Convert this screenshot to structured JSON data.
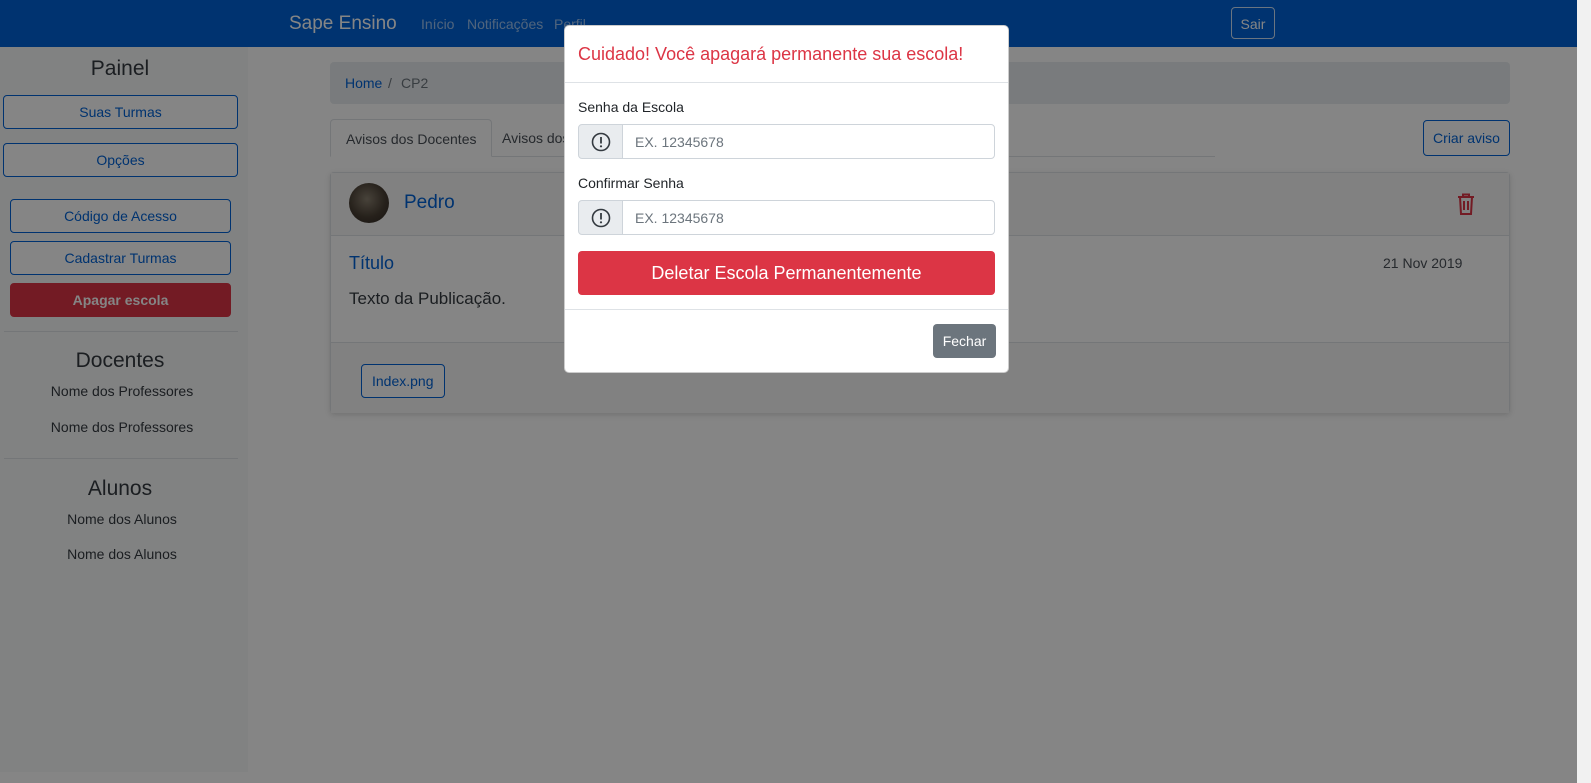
{
  "navbar": {
    "brand": "Sape Ensino",
    "links": [
      "Início",
      "Notificações",
      "Perfil"
    ],
    "logout_label": "Sair",
    "color": "#0063d6"
  },
  "sidebar": {
    "panel_title": "Painel",
    "buttons": [
      "Suas Turmas",
      "Opções",
      "Código de Acesso",
      "Cadastrar Turmas"
    ],
    "delete_school_label": "Apagar escola",
    "teachers_title": "Docentes",
    "teachers": [
      "Nome dos Professores",
      "Nome dos Professores"
    ],
    "students_title": "Alunos",
    "students": [
      "Nome dos Alunos",
      "Nome dos Alunos"
    ]
  },
  "breadcrumb": {
    "home": "Home",
    "separator": "/",
    "current": "CP2"
  },
  "tabs": [
    "Avisos dos Docentes",
    "Avisos dos Alunos"
  ],
  "create_notice_label": "Criar aviso",
  "post": {
    "author": "Pedro",
    "title": "Título",
    "date": "21 Nov 2019",
    "text": "Texto da Publicação.",
    "attachment": "Index.png",
    "delete_icon": "trash-icon"
  },
  "modal": {
    "title": "Cuidado! Você apagará permanente sua escola!",
    "password_label": "Senha da Escola",
    "password_placeholder": "EX. 12345678",
    "confirm_label": "Confirmar Senha",
    "confirm_placeholder": "EX. 12345678",
    "delete_button": "Deletar Escola Permanentemente",
    "close_button": "Fechar",
    "danger_color": "#dc3545",
    "input_icon": "exclamation-circle-icon"
  }
}
